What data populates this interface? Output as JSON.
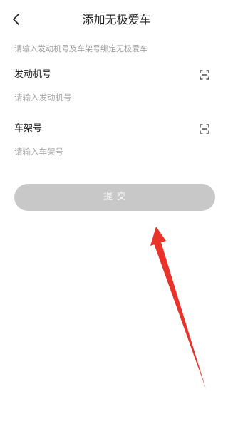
{
  "header": {
    "title": "添加无极爱车",
    "back_icon": "chevron-left-icon"
  },
  "form": {
    "hint": "请输入发动机号及车架号绑定无极爱车",
    "engine": {
      "label": "发动机号",
      "placeholder": "请输入发动机号",
      "value": "",
      "scan_icon": "scan-icon"
    },
    "frame": {
      "label": "车架号",
      "placeholder": "请输入车架号",
      "value": "",
      "scan_icon": "scan-icon"
    },
    "submit_label": "提交"
  },
  "colors": {
    "submit_disabled": "#c8c8c8",
    "annotation_arrow": "#e8322a"
  }
}
